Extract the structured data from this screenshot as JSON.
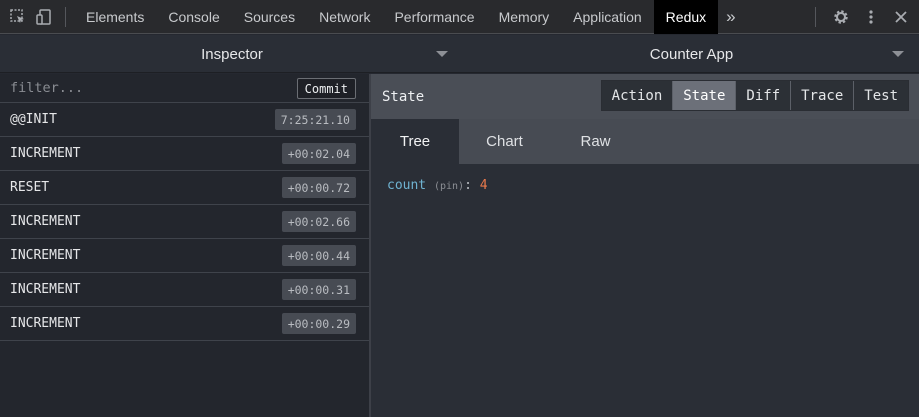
{
  "devtools": {
    "tabs": [
      {
        "label": "Elements"
      },
      {
        "label": "Console"
      },
      {
        "label": "Sources"
      },
      {
        "label": "Network"
      },
      {
        "label": "Performance"
      },
      {
        "label": "Memory"
      },
      {
        "label": "Application"
      },
      {
        "label": "Redux"
      }
    ],
    "active_tab": "Redux",
    "more_label": "»",
    "icons": [
      "inspect-element-icon",
      "device-toolbar-icon",
      "settings-gear-icon",
      "more-vertical-icon",
      "close-icon"
    ]
  },
  "selectors": {
    "left": "Inspector",
    "right": "Counter App"
  },
  "action_list": {
    "filter_placeholder": "filter...",
    "commit_label": "Commit",
    "items": [
      {
        "name": "@@INIT",
        "time": "7:25:21.10"
      },
      {
        "name": "INCREMENT",
        "time": "+00:02.04"
      },
      {
        "name": "RESET",
        "time": "+00:00.72"
      },
      {
        "name": "INCREMENT",
        "time": "+00:02.66"
      },
      {
        "name": "INCREMENT",
        "time": "+00:00.44"
      },
      {
        "name": "INCREMENT",
        "time": "+00:00.31"
      },
      {
        "name": "INCREMENT",
        "time": "+00:00.29"
      }
    ]
  },
  "monitor": {
    "title": "State",
    "tabs": [
      {
        "label": "Action"
      },
      {
        "label": "State"
      },
      {
        "label": "Diff"
      },
      {
        "label": "Trace"
      },
      {
        "label": "Test"
      }
    ],
    "active_tab": "State",
    "subtabs": [
      {
        "label": "Tree"
      },
      {
        "label": "Chart"
      },
      {
        "label": "Raw"
      }
    ],
    "active_subtab": "Tree",
    "tree": {
      "key": "count",
      "meta": "(pin)",
      "colon": ":",
      "value": "4"
    }
  },
  "colors": {
    "accent_key": "#6fb3d2",
    "accent_value": "#e9794c",
    "active_devtools_tab": "#000000"
  }
}
